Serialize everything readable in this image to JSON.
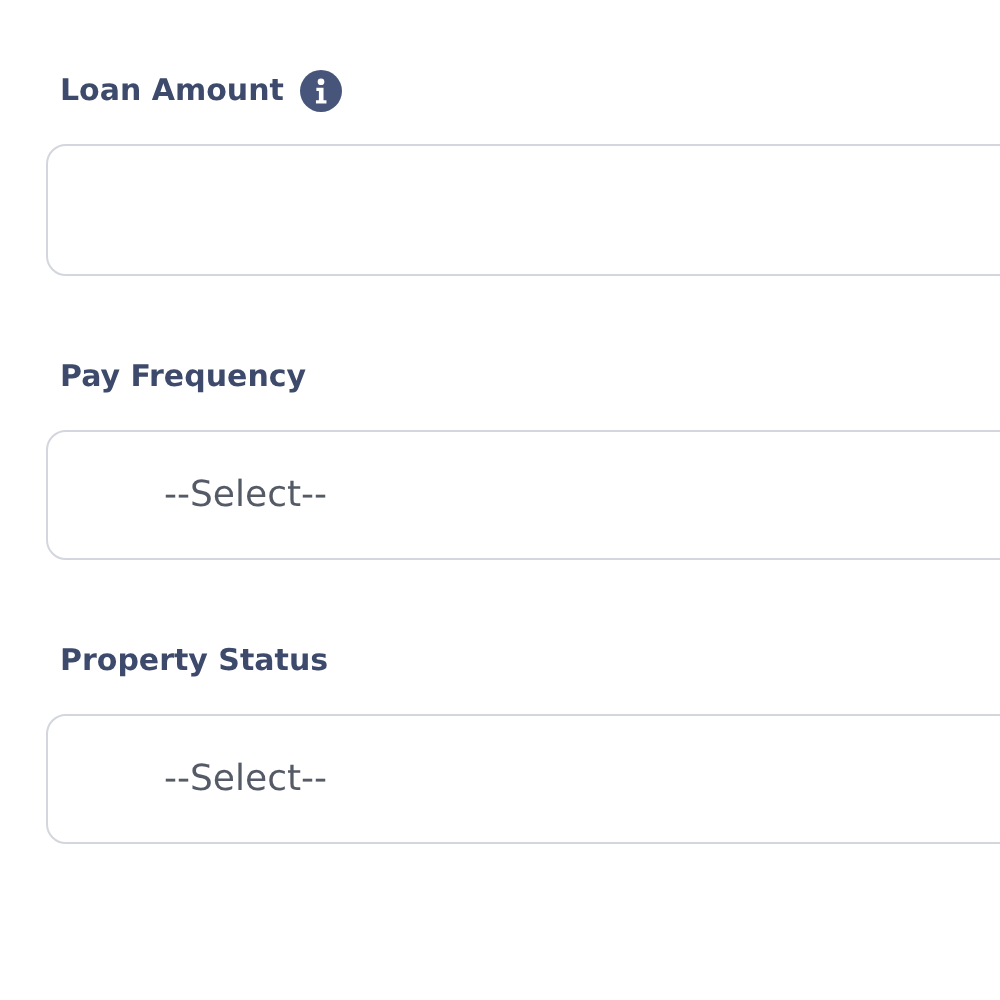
{
  "fields": [
    {
      "label": "Loan Amount",
      "kind": "text",
      "info": true
    },
    {
      "label": "Pay Frequency",
      "kind": "select",
      "info": false,
      "value": "--Select--"
    },
    {
      "label": "Property Status",
      "kind": "select",
      "info": false,
      "value": "--Select--"
    }
  ]
}
